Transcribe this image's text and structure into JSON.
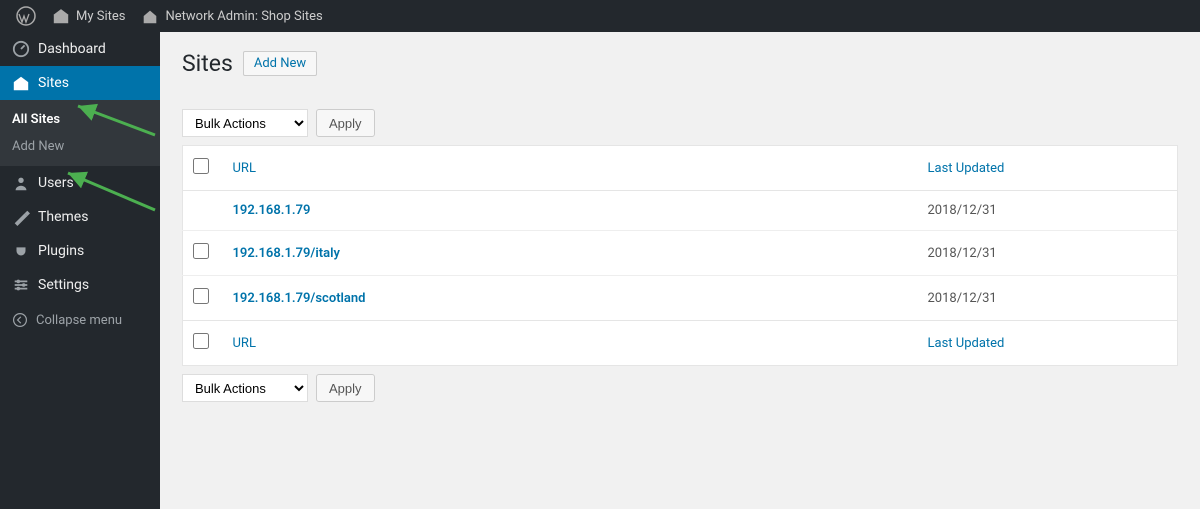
{
  "topbar": {
    "my_sites": "My Sites",
    "network_admin": "Network Admin: Shop Sites"
  },
  "sidebar": {
    "dashboard": "Dashboard",
    "sites": "Sites",
    "all_sites": "All Sites",
    "add_new": "Add New",
    "users": "Users",
    "themes": "Themes",
    "plugins": "Plugins",
    "settings": "Settings",
    "collapse": "Collapse menu"
  },
  "page": {
    "title": "Sites",
    "add_new": "Add New"
  },
  "bulk": {
    "label": "Bulk Actions",
    "apply": "Apply"
  },
  "table": {
    "url_header": "URL",
    "updated_header": "Last Updated",
    "rows": [
      {
        "url": "192.168.1.79",
        "updated": "2018/12/31"
      },
      {
        "url": "192.168.1.79/italy",
        "updated": "2018/12/31"
      },
      {
        "url": "192.168.1.79/scotland",
        "updated": "2018/12/31"
      }
    ]
  }
}
